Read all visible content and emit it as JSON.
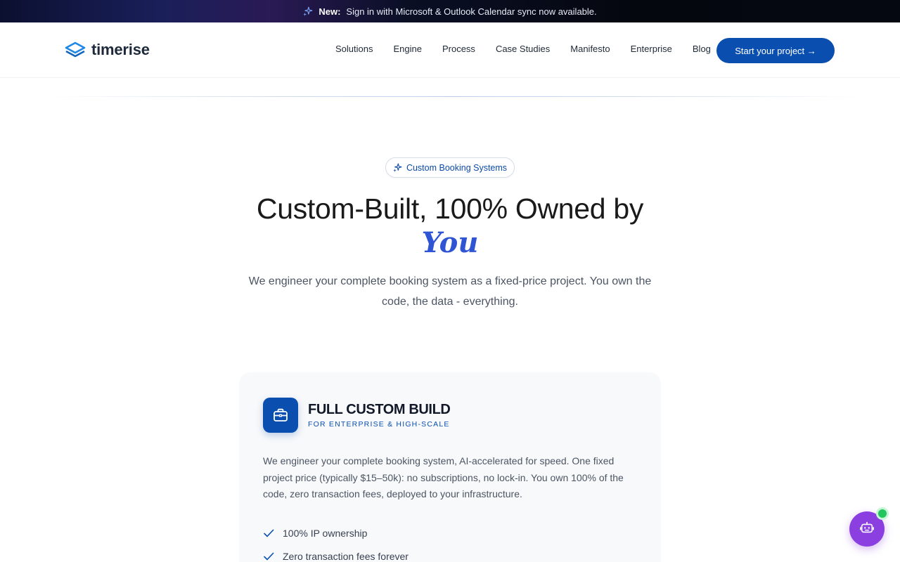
{
  "announcement": {
    "icon": "sparkle-icon",
    "prefix": "New:",
    "message": "Sign in with Microsoft & Outlook Calendar sync now available."
  },
  "header": {
    "logo_text": "timerise",
    "nav": [
      {
        "label": "Solutions"
      },
      {
        "label": "Engine"
      },
      {
        "label": "Process"
      },
      {
        "label": "Case Studies"
      },
      {
        "label": "Manifesto"
      },
      {
        "label": "Enterprise"
      },
      {
        "label": "Blog"
      }
    ],
    "cta_label": "Start your project →"
  },
  "hero": {
    "badge": "Custom Booking Systems",
    "title": "Custom-Built, 100% Owned by",
    "title_accent": "You",
    "subtitle": "We engineer your complete booking system as a fixed-price project. You own the code, the data - everything."
  },
  "card": {
    "icon": "briefcase-icon",
    "title": "FULL CUSTOM BUILD",
    "tag": "FOR ENTERPRISE & HIGH-SCALE",
    "description": "We engineer your complete booking system, AI-accelerated for speed. One fixed project price (typically $15–50k): no subscriptions, no lock-in. You own 100% of the code, zero transaction fees, deployed to your infrastructure.",
    "features": [
      {
        "label": "100% IP ownership"
      },
      {
        "label": "Zero transaction fees forever"
      }
    ]
  },
  "chat_widget": {
    "icon": "bot-icon",
    "status": "online"
  },
  "colors": {
    "brand_blue": "#0a4fb0",
    "accent_blue": "#2f55d4",
    "chat_purple": "#8b3fe0",
    "online_green": "#22c55e"
  }
}
